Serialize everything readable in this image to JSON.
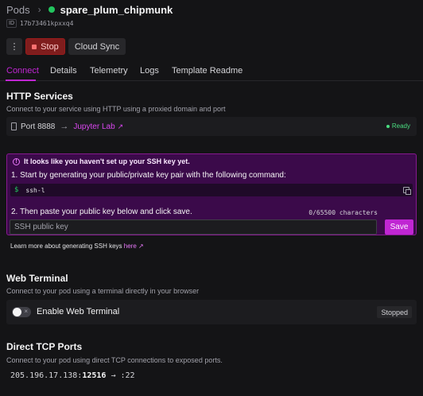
{
  "header": {
    "crumb": "Pods",
    "pod_name": "spare_plum_chipmunk",
    "id_label": "ID",
    "id_value": "17b73461kpxxq4"
  },
  "actions": {
    "more": "⋮",
    "stop": "Stop",
    "cloud_sync": "Cloud Sync"
  },
  "tabs": [
    "Connect",
    "Details",
    "Telemetry",
    "Logs",
    "Template Readme"
  ],
  "http": {
    "title": "HTTP Services",
    "desc": "Connect to your service using HTTP using a proxied domain and port",
    "port": "Port 8888",
    "arrow": "→",
    "link": "Jupyter Lab",
    "status": "Ready"
  },
  "ssh": {
    "warning": "It looks like you haven't set up your SSH key yet.",
    "step1": "1. Start by generating your public/private key pair with the following command:",
    "prompt": "$",
    "command": "ssh-l",
    "step2": "2. Then paste your public key below and click save.",
    "counter": "0/65500 characters",
    "placeholder": "SSH public key",
    "save": "Save",
    "learn_prefix": "Learn more about generating SSH keys",
    "learn_link": "here"
  },
  "web_terminal": {
    "title": "Web Terminal",
    "desc": "Connect to your pod using a terminal directly in your browser",
    "toggle_label": "Enable Web Terminal",
    "status": "Stopped"
  },
  "tcp": {
    "title": "Direct TCP Ports",
    "desc": "Connect to your pod using direct TCP connections to exposed ports.",
    "ip": "205.196.17.138:",
    "port": "12516",
    "arrow": "→",
    "internal": ":22"
  },
  "colors": {
    "accent": "#c026d3",
    "ready": "#4ade80",
    "stop": "#7f1d1d"
  }
}
